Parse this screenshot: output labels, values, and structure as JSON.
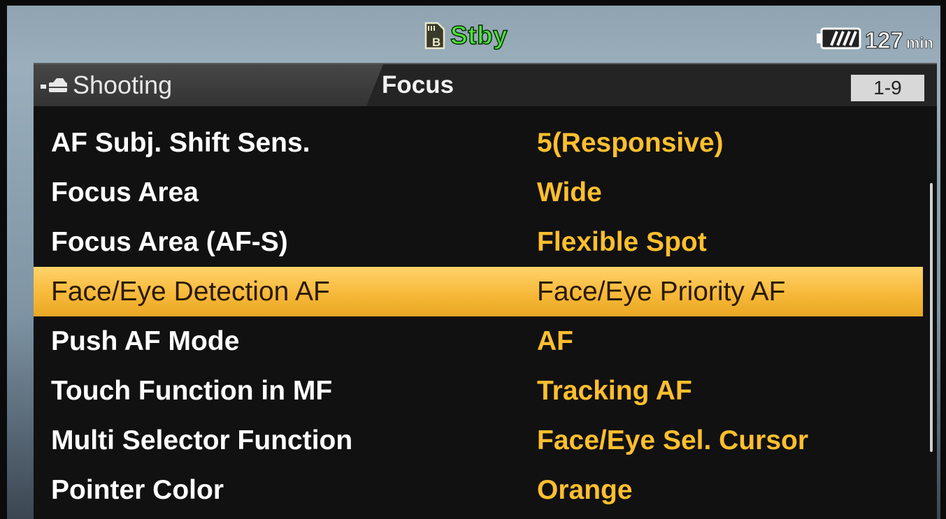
{
  "status": {
    "media_state": "Stby",
    "battery_minutes": "127",
    "battery_unit": "min",
    "stby_color": "#4ee23a"
  },
  "header": {
    "section": "Shooting",
    "subsection": "Focus",
    "page": "1-9",
    "section_icon": "camera-shooting-icon"
  },
  "menu": {
    "items": [
      {
        "label": "AF Subj. Shift Sens.",
        "value": "5(Responsive)"
      },
      {
        "label": "Focus Area",
        "value": "Wide"
      },
      {
        "label": "Focus Area (AF-S)",
        "value": "Flexible Spot"
      },
      {
        "label": "Face/Eye Detection AF",
        "value": "Face/Eye Priority AF"
      },
      {
        "label": "Push AF Mode",
        "value": "AF"
      },
      {
        "label": "Touch Function in MF",
        "value": "Tracking AF"
      },
      {
        "label": "Multi Selector Function",
        "value": "Face/Eye Sel. Cursor"
      },
      {
        "label": "Pointer Color",
        "value": "Orange"
      }
    ],
    "selected_index": 3
  },
  "colors": {
    "label_text": "#ffffff",
    "value_text": "#ffbf2e",
    "highlight": "#f7b93a"
  }
}
